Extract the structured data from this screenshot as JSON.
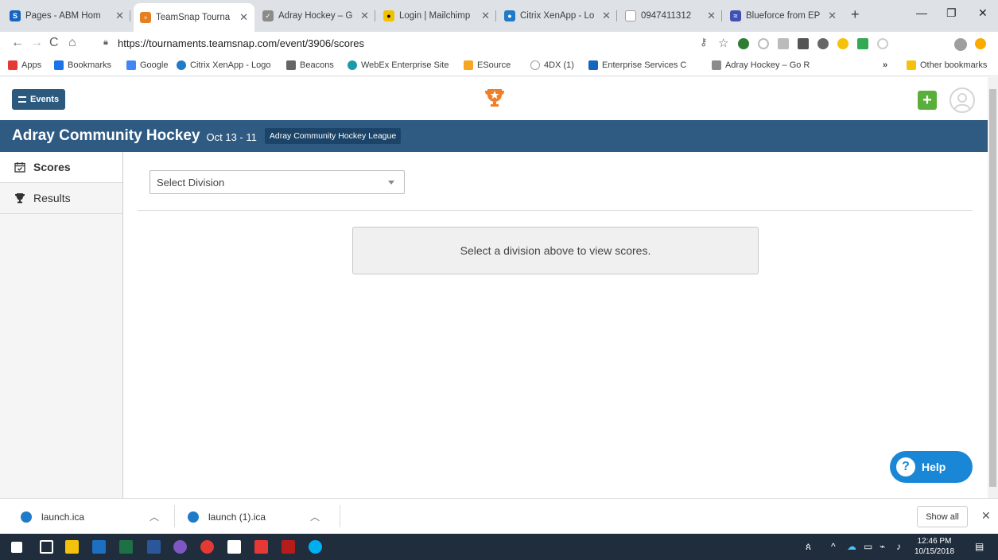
{
  "browser": {
    "tabs": [
      {
        "title": "Pages - ABM Hom",
        "color": "#1565c0",
        "glyph": "S"
      },
      {
        "title": "TeamSnap Tourna",
        "color": "#e67e22",
        "glyph": "♆"
      },
      {
        "title": "Adray Hockey – G",
        "color": "#8b8b8b",
        "glyph": "✓"
      },
      {
        "title": "Login | Mailchimp",
        "color": "#f2c200",
        "glyph": "●"
      },
      {
        "title": "Citrix XenApp - Lo",
        "color": "#1f7ac7",
        "glyph": "●"
      },
      {
        "title": "0947411312",
        "color": "#9e9e9e",
        "glyph": ""
      },
      {
        "title": "Blueforce from EP",
        "color": "#3f51b5",
        "glyph": "≈"
      }
    ],
    "url": "https://tournaments.teamsnap.com/event/3906/scores",
    "bookmarks": [
      {
        "label": "Apps",
        "color": "#e53935"
      },
      {
        "label": "Bookmarks",
        "color": "#1a73e8"
      },
      {
        "label": "Google",
        "color": "#4285f4"
      },
      {
        "label": "Citrix XenApp - Logo",
        "color": "#1f7ac7"
      },
      {
        "label": "Beacons",
        "color": "#666666"
      },
      {
        "label": "WebEx Enterprise Site",
        "color": "#1b9aaa"
      },
      {
        "label": "ESource",
        "color": "#f5a623"
      },
      {
        "label": "4DX (1)",
        "color": "#9e9e9e"
      },
      {
        "label": "Enterprise Services C",
        "color": "#1565c0"
      },
      {
        "label": "Adray Hockey – Go R",
        "color": "#8b8b8b"
      }
    ],
    "other_bookmarks": "Other bookmarks",
    "more_bookmarks": "»"
  },
  "header": {
    "events_label": "Events",
    "add_label": "+"
  },
  "banner": {
    "title": "Adray Community Hockey",
    "dates": "Oct 13 - 11",
    "league": "Adray Community Hockey League"
  },
  "sidebar": {
    "items": [
      {
        "label": "Scores",
        "active": true
      },
      {
        "label": "Results",
        "active": false
      }
    ]
  },
  "main": {
    "division_select": "Select Division",
    "notice": "Select a division above to view scores.",
    "help_label": "Help"
  },
  "downloads": {
    "items": [
      "launch.ica",
      "launch (1).ica"
    ],
    "show_all": "Show all"
  },
  "taskbar": {
    "time": "12:46 PM",
    "date": "10/15/2018"
  }
}
